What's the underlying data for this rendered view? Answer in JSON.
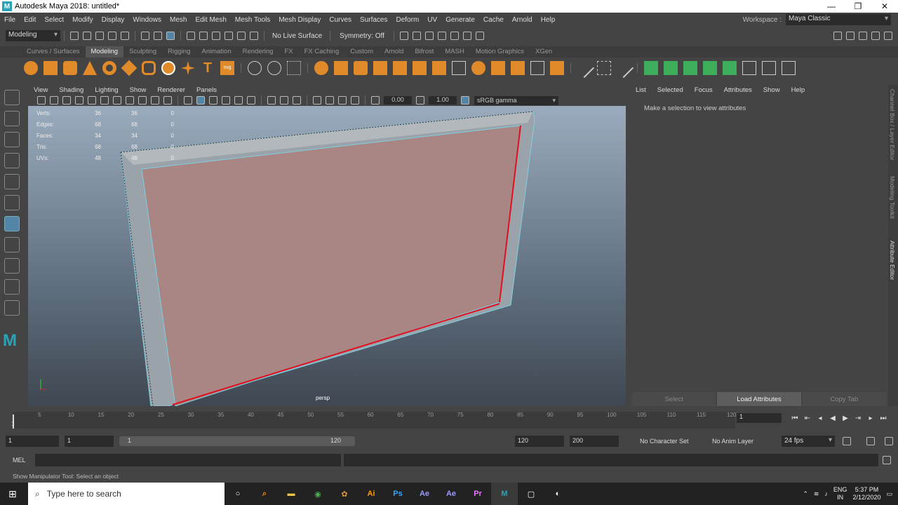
{
  "window": {
    "title": "Autodesk Maya 2018: untitled*",
    "logo": "M",
    "controls": [
      "—",
      "❐",
      "✕"
    ]
  },
  "menubar": [
    "File",
    "Edit",
    "Select",
    "Modify",
    "Display",
    "Windows",
    "Mesh",
    "Edit Mesh",
    "Mesh Tools",
    "Mesh Display",
    "Curves",
    "Surfaces",
    "Deform",
    "UV",
    "Generate",
    "Cache",
    "Arnold",
    "Help"
  ],
  "workspace": {
    "label": "Workspace :",
    "value": "Maya Classic"
  },
  "statusline": {
    "mode": "Modeling",
    "live_surface": "No Live Surface",
    "symmetry": "Symmetry: Off"
  },
  "shelf_tabs": [
    "Curves / Surfaces",
    "Modeling",
    "Sculpting",
    "Rigging",
    "Animation",
    "Rendering",
    "FX",
    "FX Caching",
    "Custom",
    "Arnold",
    "Bifrost",
    "MASH",
    "Motion Graphics",
    "XGen"
  ],
  "shelf_active": "Modeling",
  "viewport": {
    "menu": [
      "View",
      "Shading",
      "Lighting",
      "Show",
      "Renderer",
      "Panels"
    ],
    "field1": "0.00",
    "field2": "1.00",
    "colorspace": "sRGB gamma",
    "camera": "persp",
    "hud": [
      {
        "label": "Verts:",
        "a": "36",
        "b": "36",
        "c": "0"
      },
      {
        "label": "Edges:",
        "a": "68",
        "b": "68",
        "c": "0"
      },
      {
        "label": "Faces:",
        "a": "34",
        "b": "34",
        "c": "0"
      },
      {
        "label": "Tris:",
        "a": "68",
        "b": "68",
        "c": "0"
      },
      {
        "label": "UVs:",
        "a": "48",
        "b": "48",
        "c": "0"
      }
    ]
  },
  "attribute_editor": {
    "menu": [
      "List",
      "Selected",
      "Focus",
      "Attributes",
      "Show",
      "Help"
    ],
    "message": "Make a selection to view attributes",
    "buttons": [
      "Select",
      "Load Attributes",
      "Copy Tab"
    ]
  },
  "side_tabs": [
    "Channel Box / Layer Editor",
    "Modeling Toolkit",
    "Attribute Editor"
  ],
  "timeline": {
    "ticks": [
      "5",
      "10",
      "15",
      "20",
      "25",
      "30",
      "35",
      "40",
      "45",
      "50",
      "55",
      "60",
      "65",
      "70",
      "75",
      "80",
      "85",
      "90",
      "95",
      "100",
      "105",
      "110",
      "115",
      "120"
    ],
    "first": "1",
    "current_frame": "1"
  },
  "range": {
    "start": "1",
    "playback_start": "1",
    "slider_start": "1",
    "slider_end": "120",
    "playback_end": "120",
    "end": "200",
    "character_set": "No Character Set",
    "anim_layer": "No Anim Layer",
    "fps": "24 fps"
  },
  "command_line": {
    "label": "MEL"
  },
  "help_line": "Show Manipulator Tool: Select an object",
  "taskbar": {
    "search_placeholder": "Type here to search",
    "apps": [
      "Ai",
      "Ps",
      "Ae",
      "Ae",
      "Pr",
      "M"
    ],
    "lang": "ENG",
    "region": "IN",
    "time": "5:37 PM",
    "date": "2/12/2020"
  }
}
